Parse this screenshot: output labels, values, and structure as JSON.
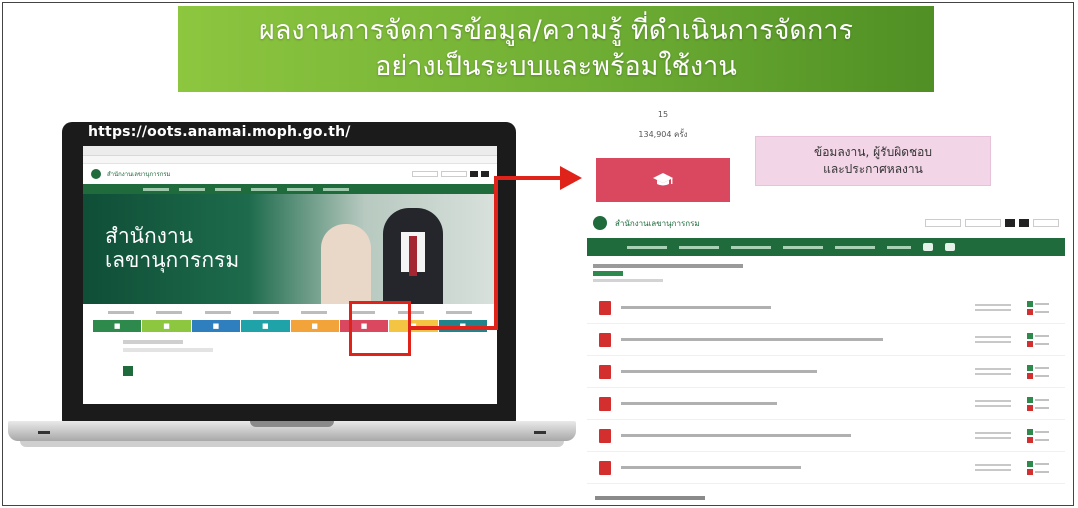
{
  "banner": {
    "line1": "ผลงานการจัดการข้อมูล/ความรู้ ที่ดำเนินการจัดการ",
    "line2": "อย่างเป็นระบบและพร้อมใช้งาน"
  },
  "laptop": {
    "url": "https://oots.anamai.moph.go.th/",
    "hero_line1": "สำนักงาน",
    "hero_line2": "เลขานุการกรม"
  },
  "card": {
    "number": "15",
    "count": "134,904 ครั้ง"
  },
  "callout": {
    "line1": "ข้อมลงาน, ผู้รับผิดชอบ",
    "line2": "และประกาศหลงาน"
  },
  "page": {
    "site_name": "สำนักงานเลขานุการกรม"
  },
  "colors": {
    "banner_green": "#6fae34",
    "site_green": "#1f6b3c",
    "highlight_red": "#e0231a",
    "card_button": "#d9485f",
    "callout_pink": "#f3d5e8"
  },
  "icons": {
    "card_button": "graduation-cap-icon",
    "file": "pdf-file-icon"
  }
}
